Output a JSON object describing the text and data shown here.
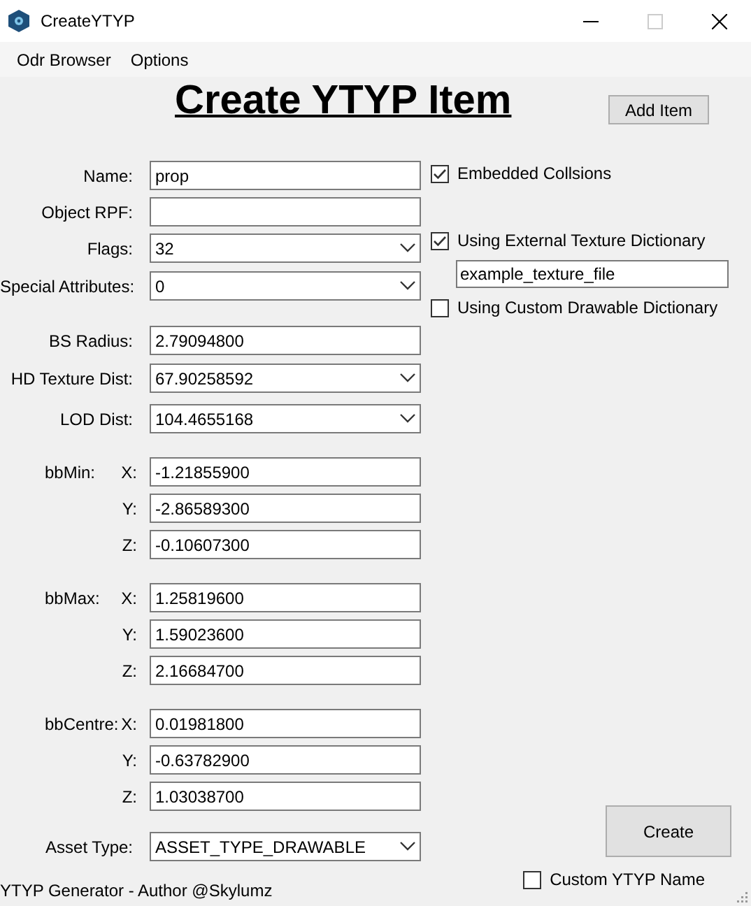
{
  "window": {
    "title": "CreateYTYP"
  },
  "menu": [
    "Odr Browser",
    "Options"
  ],
  "heading": "Create YTYP Item",
  "add_button": "Add Item",
  "fields": [
    {
      "kind": "text",
      "label": "Name:",
      "value": "prop"
    },
    {
      "kind": "text",
      "label": "Object RPF:"
    },
    {
      "kind": "dropdown",
      "label": "Flags:",
      "value": "32"
    },
    {
      "kind": "dropdown",
      "label": "Special Attributes:",
      "value": "0"
    }
  ],
  "distances": [
    {
      "kind": "text",
      "label": "BS Radius:",
      "value": "2.79094800"
    },
    {
      "kind": "dropdown",
      "label": "HD Texture Dist:",
      "value": "67.90258592"
    },
    {
      "kind": "dropdown",
      "label": "LOD Dist:",
      "value": "104.4655168"
    }
  ],
  "bounds": [
    {
      "label": "bbMin:",
      "axes": [
        {
          "label": "X:",
          "value": "-1.21855900"
        },
        {
          "label": "Y:",
          "value": "-2.86589300"
        },
        {
          "label": "Z:",
          "value": "-0.10607300"
        }
      ]
    },
    {
      "label": "bbMax:",
      "axes": [
        {
          "label": "X:",
          "value": "1.25819600"
        },
        {
          "label": "Y:",
          "value": "1.59023600"
        },
        {
          "label": "Z:",
          "value": "2.16684700"
        }
      ]
    },
    {
      "label": "bbCentre:",
      "axes": [
        {
          "label": "X:",
          "value": "0.01981800"
        },
        {
          "label": "Y:",
          "value": "-0.63782900"
        },
        {
          "label": "Z:",
          "value": "1.03038700"
        }
      ]
    }
  ],
  "asset_type": {
    "kind": "dropdown",
    "label": "Asset Type:",
    "value": "ASSET_TYPE_DRAWABLE"
  },
  "options": {
    "embedded_collisions": {
      "label": "Embedded Collsions",
      "checked": true
    },
    "external_texture": {
      "label": "Using External Texture Dictionary",
      "checked": true,
      "value": "example_texture_file"
    },
    "custom_drawable": {
      "label": "Using Custom Drawable Dictionary",
      "checked": false
    }
  },
  "create_button": "Create",
  "custom_name": {
    "label": "Custom YTYP Name",
    "checked": false
  },
  "footer": "YTYP Generator - Author @Skylumz"
}
